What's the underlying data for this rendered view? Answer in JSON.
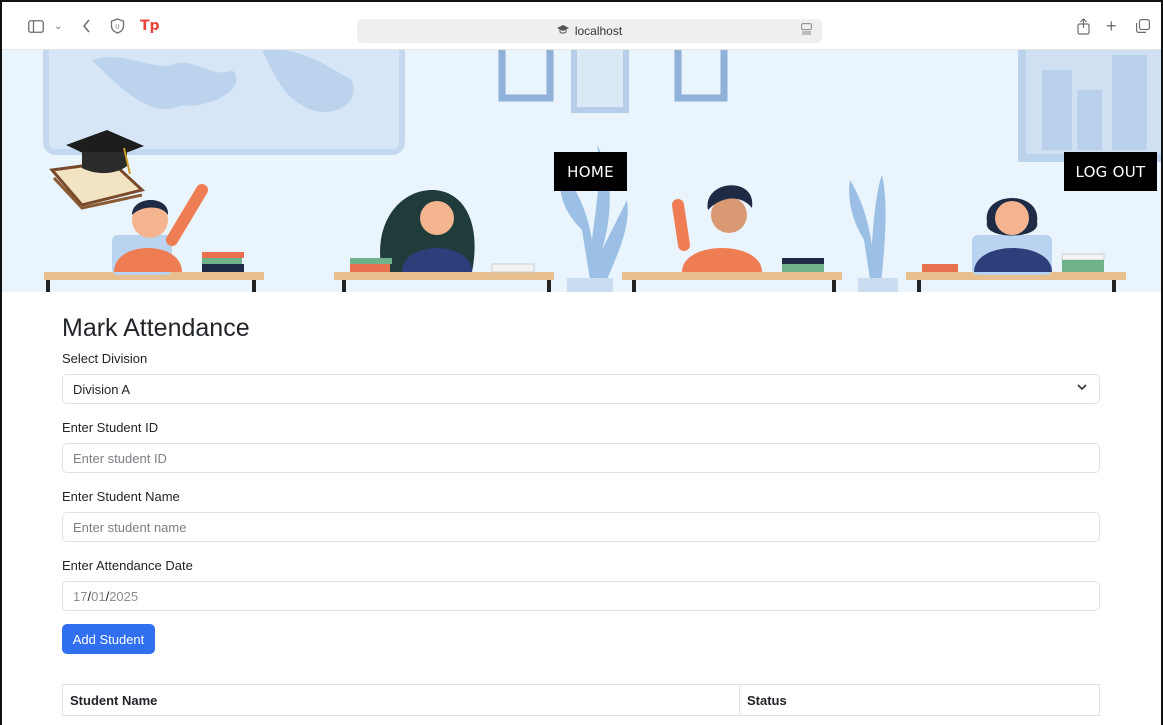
{
  "browser": {
    "url": "localhost"
  },
  "nav": {
    "home": "HOME",
    "logout": "LOG OUT"
  },
  "form": {
    "title": "Mark Attendance",
    "division_label": "Select Division",
    "division_value": "Division A",
    "student_id_label": "Enter Student ID",
    "student_id_placeholder": "Enter student ID",
    "student_name_label": "Enter Student Name",
    "student_name_placeholder": "Enter student name",
    "date_label": "Enter Attendance Date",
    "date_day": "17",
    "date_sep1": "/",
    "date_month": "01",
    "date_sep2": "/",
    "date_year": "2025",
    "submit": "Add Student"
  },
  "table": {
    "headers": [
      "Student Name",
      "Status"
    ]
  },
  "colors": {
    "accent": "#2f6ff0",
    "hero_bg": "#eaf4fd",
    "nav_bg": "#000000"
  },
  "icons": [
    "sidebar-icon",
    "chevron-down-icon",
    "back-icon",
    "shield-icon",
    "tp-icon",
    "site-icon",
    "reader-icon",
    "share-icon",
    "plus-icon",
    "tabs-icon",
    "graduation-cap-icon"
  ]
}
